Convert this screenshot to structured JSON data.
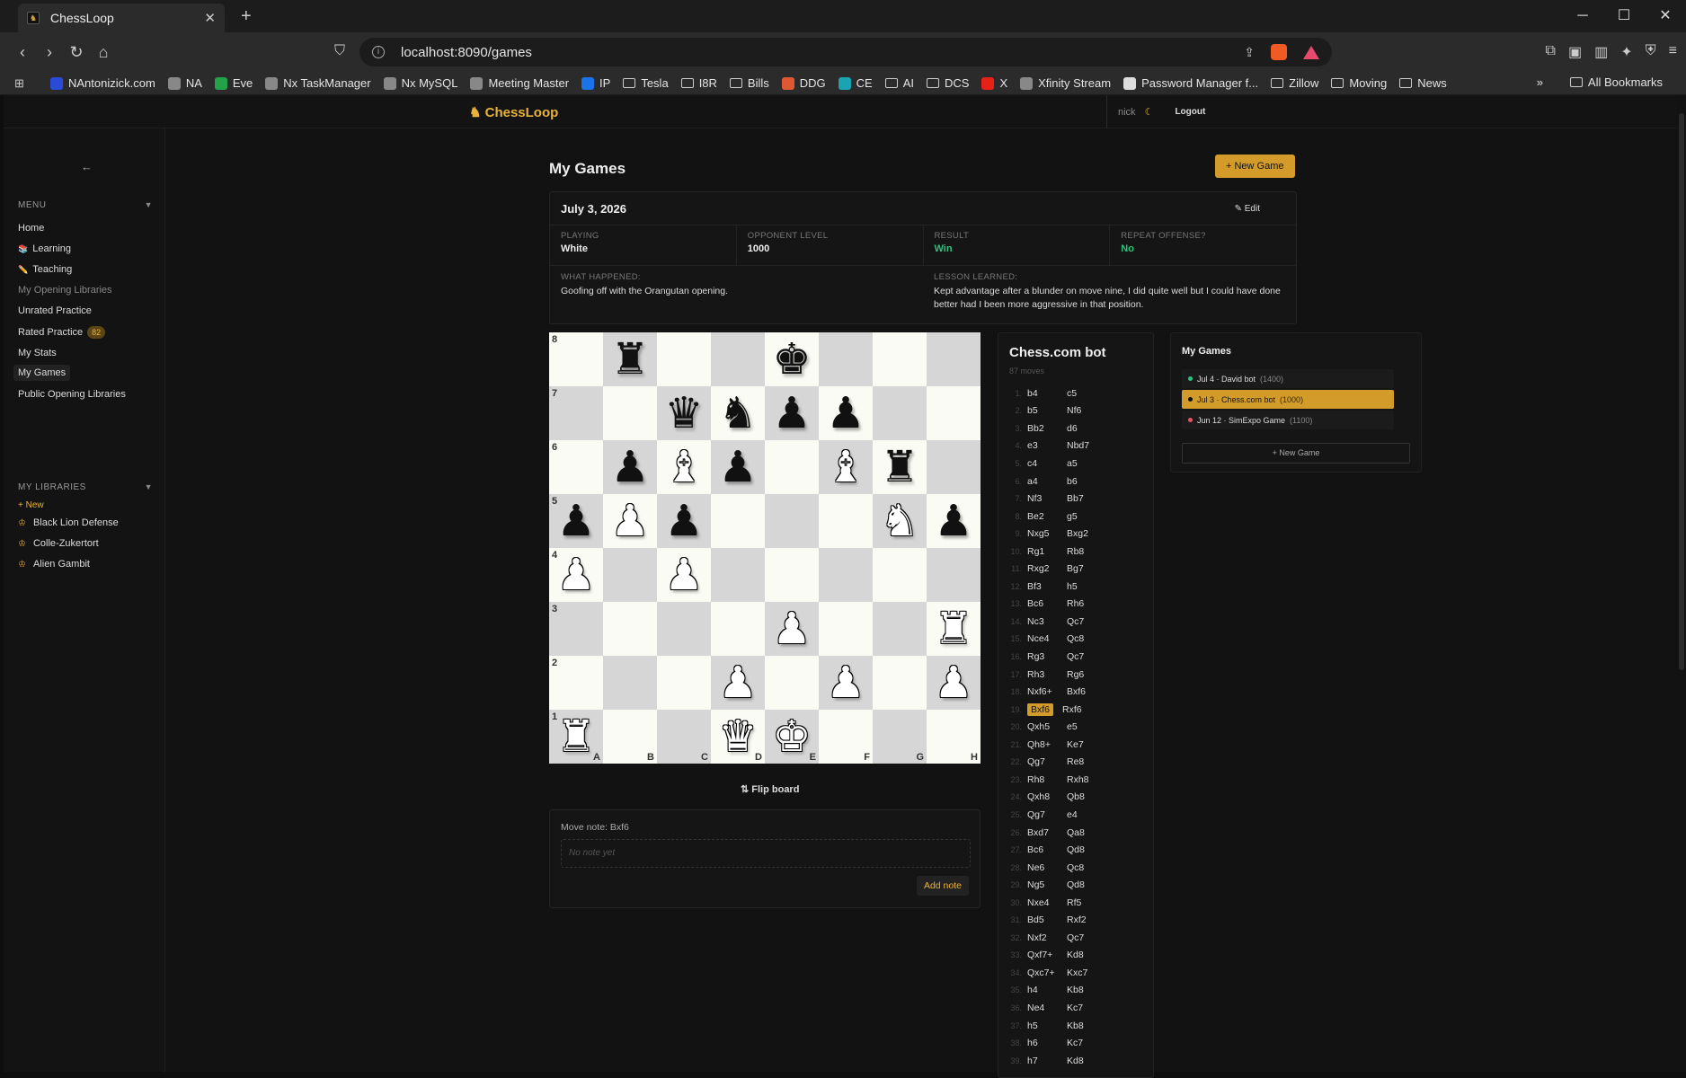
{
  "browser": {
    "tab_title": "ChessLoop",
    "url": "localhost:8090/games",
    "bookmarks": [
      {
        "label": "NAntonizick.com",
        "type": "site",
        "color": "#2a4bd6"
      },
      {
        "label": "NA",
        "type": "site",
        "color": "#888"
      },
      {
        "label": "Eve",
        "type": "site",
        "color": "#22a34a"
      },
      {
        "label": "Nx TaskManager",
        "type": "site",
        "color": "#888"
      },
      {
        "label": "Nx MySQL",
        "type": "site",
        "color": "#888"
      },
      {
        "label": "Meeting Master",
        "type": "site",
        "color": "#888"
      },
      {
        "label": "IP",
        "type": "site",
        "color": "#1a73e8"
      },
      {
        "label": "Tesla",
        "type": "folder"
      },
      {
        "label": "I8R",
        "type": "folder"
      },
      {
        "label": "Bills",
        "type": "folder"
      },
      {
        "label": "DDG",
        "type": "site",
        "color": "#de5833"
      },
      {
        "label": "CE",
        "type": "site",
        "color": "#1aa3b3"
      },
      {
        "label": "AI",
        "type": "folder"
      },
      {
        "label": "DCS",
        "type": "folder"
      },
      {
        "label": "X",
        "type": "site",
        "color": "#e62117"
      },
      {
        "label": "Xfinity Stream",
        "type": "site",
        "color": "#888"
      },
      {
        "label": "Password Manager f...",
        "type": "site",
        "color": "#ddd"
      },
      {
        "label": "Zillow",
        "type": "folder"
      },
      {
        "label": "Moving",
        "type": "folder"
      },
      {
        "label": "News",
        "type": "folder"
      }
    ],
    "all_bookmarks": "All Bookmarks",
    "more": "»"
  },
  "app": {
    "brand": "ChessLoop",
    "user": "nick",
    "logout": "Logout",
    "back": "←",
    "menu_header": "MENU",
    "menu": [
      {
        "label": "Home",
        "icon": ""
      },
      {
        "label": "Learning",
        "icon": "📚"
      },
      {
        "label": "Teaching",
        "icon": "✏️"
      },
      {
        "label": "My Opening Libraries",
        "icon": "",
        "dim": true
      },
      {
        "label": "Unrated Practice",
        "icon": ""
      },
      {
        "label": "Rated Practice",
        "icon": "",
        "badge": "82"
      },
      {
        "label": "My Stats",
        "icon": ""
      },
      {
        "label": "My Games",
        "icon": "",
        "active": true
      },
      {
        "label": "Public Opening Libraries",
        "icon": ""
      }
    ],
    "libraries_header": "MY LIBRARIES",
    "new_library": "+ New",
    "libraries": [
      "Black Lion Defense",
      "Colle-Zukertort",
      "Alien Gambit"
    ]
  },
  "page": {
    "title": "My Games",
    "new_game": "+ New Game",
    "game": {
      "date": "July 3, 2026",
      "edit": "✎ Edit",
      "playing_label": "PLAYING",
      "playing": "White",
      "opponent_label": "OPPONENT LEVEL",
      "opponent": "1000",
      "result_label": "RESULT",
      "result": "Win",
      "repeat_label": "REPEAT OFFENSE?",
      "repeat": "No",
      "what_label": "WHAT HAPPENED:",
      "what": "Goofing off with the Orangutan opening.",
      "lesson_label": "LESSON LEARNED:",
      "lesson": "Kept advantage after a blunder on move nine, I did quite well but I could have done better had I been more aggressive in that position."
    },
    "board": [
      [
        "",
        "bR",
        "",
        "",
        "bK",
        "",
        "",
        ""
      ],
      [
        "",
        "",
        "bQ",
        "bN",
        "bP",
        "bP",
        "",
        ""
      ],
      [
        "",
        "bP",
        "wB",
        "bP",
        "",
        "wB",
        "bR",
        ""
      ],
      [
        "bP",
        "wP",
        "bP",
        "",
        "",
        "",
        "wN",
        "bP"
      ],
      [
        "wP",
        "",
        "wP",
        "",
        "",
        "",
        "",
        ""
      ],
      [
        "",
        "",
        "",
        "",
        "wP",
        "",
        "",
        "wR"
      ],
      [
        "",
        "",
        "",
        "wP",
        "",
        "wP",
        "",
        "wP"
      ],
      [
        "wR",
        "",
        "",
        "wQ",
        "wK",
        "",
        "",
        ""
      ]
    ],
    "ranks": [
      "8",
      "7",
      "6",
      "5",
      "4",
      "3",
      "2",
      "1"
    ],
    "files": [
      "A",
      "B",
      "C",
      "D",
      "E",
      "F",
      "G",
      "H"
    ],
    "flip": "⇅ Flip board",
    "note_label": "Move note: Bxf6",
    "note_placeholder": "No note yet",
    "add_note": "Add note"
  },
  "moves_panel": {
    "title": "Chess.com bot",
    "count": "87 moves",
    "highlight_index": 18,
    "moves": [
      [
        "b4",
        "c5"
      ],
      [
        "b5",
        "Nf6"
      ],
      [
        "Bb2",
        "d6"
      ],
      [
        "e3",
        "Nbd7"
      ],
      [
        "c4",
        "a5"
      ],
      [
        "a4",
        "b6"
      ],
      [
        "Nf3",
        "Bb7"
      ],
      [
        "Be2",
        "g5"
      ],
      [
        "Nxg5",
        "Bxg2"
      ],
      [
        "Rg1",
        "Rb8"
      ],
      [
        "Rxg2",
        "Bg7"
      ],
      [
        "Bf3",
        "h5"
      ],
      [
        "Bc6",
        "Rh6"
      ],
      [
        "Nc3",
        "Qc7"
      ],
      [
        "Nce4",
        "Qc8"
      ],
      [
        "Rg3",
        "Qc7"
      ],
      [
        "Rh3",
        "Rg6"
      ],
      [
        "Nxf6+",
        "Bxf6"
      ],
      [
        "Bxf6",
        "Rxf6"
      ],
      [
        "Qxh5",
        "e5"
      ],
      [
        "Qh8+",
        "Ke7"
      ],
      [
        "Qg7",
        "Re8"
      ],
      [
        "Rh8",
        "Rxh8"
      ],
      [
        "Qxh8",
        "Qb8"
      ],
      [
        "Qg7",
        "e4"
      ],
      [
        "Bxd7",
        "Qa8"
      ],
      [
        "Bc6",
        "Qd8"
      ],
      [
        "Ne6",
        "Qc8"
      ],
      [
        "Ng5",
        "Qd8"
      ],
      [
        "Nxe4",
        "Rf5"
      ],
      [
        "Bd5",
        "Rxf2"
      ],
      [
        "Nxf2",
        "Qc7"
      ],
      [
        "Qxf7+",
        "Kd8"
      ],
      [
        "Qxc7+",
        "Kxc7"
      ],
      [
        "h4",
        "Kb8"
      ],
      [
        "Ne4",
        "Kc7"
      ],
      [
        "h5",
        "Kb8"
      ],
      [
        "h6",
        "Kc7"
      ],
      [
        "h7",
        "Kd8"
      ]
    ]
  },
  "games_panel": {
    "title": "My Games",
    "items": [
      {
        "label": "Jul 4 · David bot",
        "sub": "(1400)",
        "dot": "#2ec37c",
        "selected": false
      },
      {
        "label": "Jul 3 · Chess.com bot",
        "sub": "(1000)",
        "dot": "#2ec37c",
        "selected": true
      },
      {
        "label": "Jun 12 · SimExpo Game",
        "sub": "(1100)",
        "dot": "#e0555f",
        "selected": false
      }
    ],
    "new_game": "+ New Game"
  }
}
